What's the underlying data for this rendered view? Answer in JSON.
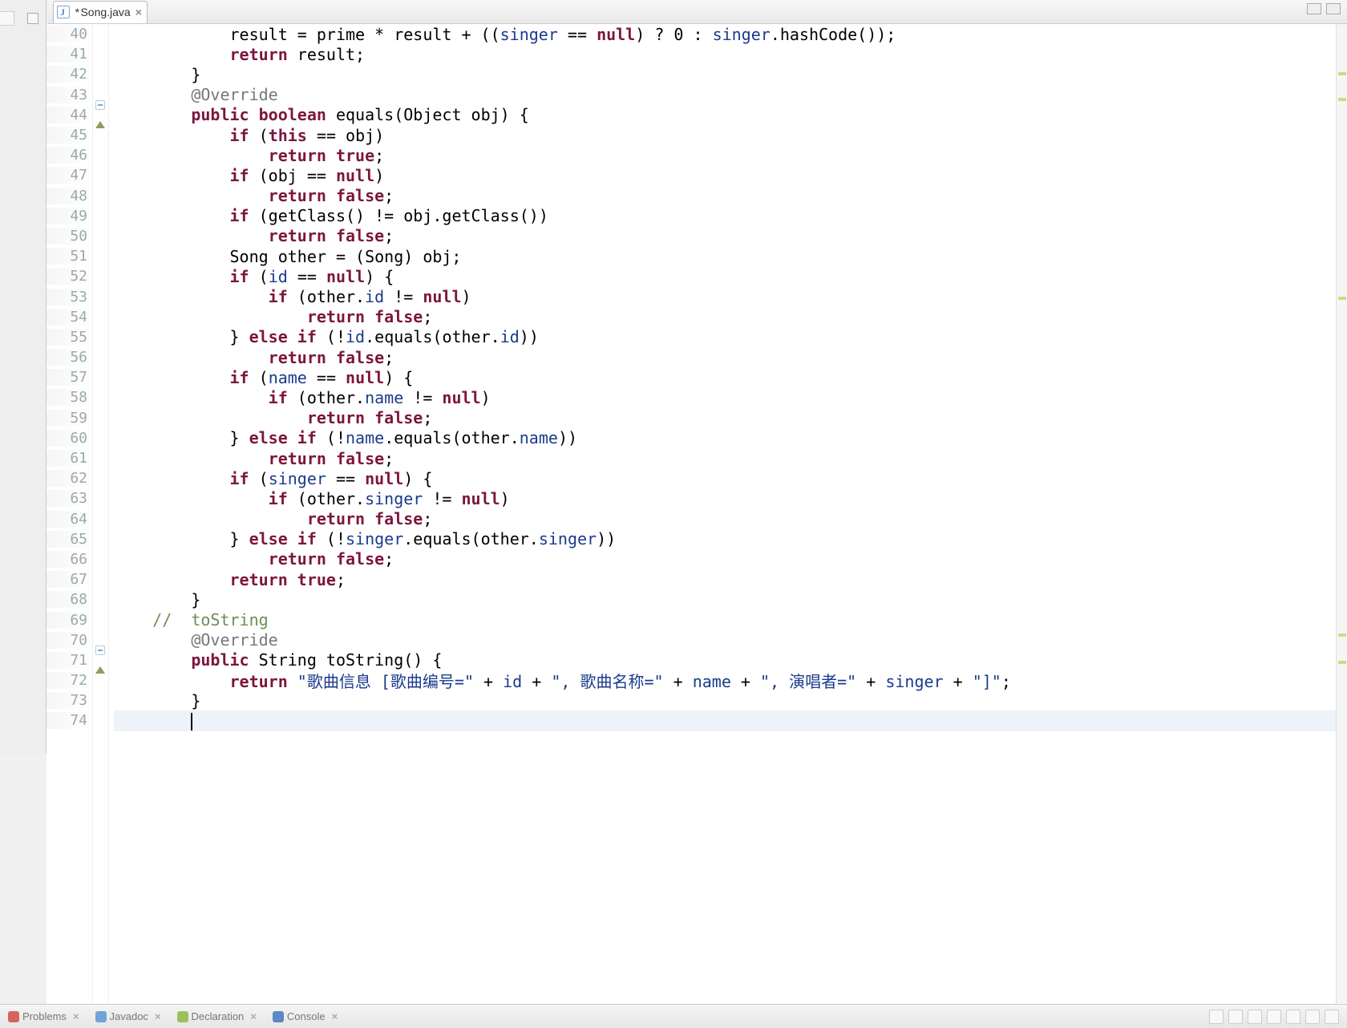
{
  "tab": {
    "filename": "Song.java",
    "dirty": true
  },
  "lines": [
    {
      "n": 40,
      "html": "            result = prime * result + ((<span class='fld'>singer</span> == <span class='kw'>null</span>) ? 0 : <span class='fld'>singer</span>.hashCode());"
    },
    {
      "n": 41,
      "html": "            <span class='kw'>return</span> result;"
    },
    {
      "n": 42,
      "html": "        }"
    },
    {
      "n": 43,
      "fold": true,
      "html": "        <span class='anno'>@Override</span>"
    },
    {
      "n": 44,
      "override": true,
      "html": "        <span class='kw'>public</span> <span class='kw'>boolean</span> equals(Object obj) {"
    },
    {
      "n": 45,
      "html": "            <span class='kw'>if</span> (<span class='kw'>this</span> == obj)"
    },
    {
      "n": 46,
      "html": "                <span class='kw'>return</span> <span class='kw'>true</span>;"
    },
    {
      "n": 47,
      "html": "            <span class='kw'>if</span> (obj == <span class='kw'>null</span>)"
    },
    {
      "n": 48,
      "html": "                <span class='kw'>return</span> <span class='kw'>false</span>;"
    },
    {
      "n": 49,
      "html": "            <span class='kw'>if</span> (getClass() != obj.getClass())"
    },
    {
      "n": 50,
      "html": "                <span class='kw'>return</span> <span class='kw'>false</span>;"
    },
    {
      "n": 51,
      "html": "            Song other = (Song) obj;"
    },
    {
      "n": 52,
      "html": "            <span class='kw'>if</span> (<span class='fld'>id</span> == <span class='kw'>null</span>) {"
    },
    {
      "n": 53,
      "html": "                <span class='kw'>if</span> (other.<span class='fld'>id</span> != <span class='kw'>null</span>)"
    },
    {
      "n": 54,
      "html": "                    <span class='kw'>return</span> <span class='kw'>false</span>;"
    },
    {
      "n": 55,
      "html": "            } <span class='kw'>else</span> <span class='kw'>if</span> (!<span class='fld'>id</span>.equals(other.<span class='fld'>id</span>))"
    },
    {
      "n": 56,
      "html": "                <span class='kw'>return</span> <span class='kw'>false</span>;"
    },
    {
      "n": 57,
      "html": "            <span class='kw'>if</span> (<span class='fld'>name</span> == <span class='kw'>null</span>) {"
    },
    {
      "n": 58,
      "html": "                <span class='kw'>if</span> (other.<span class='fld'>name</span> != <span class='kw'>null</span>)"
    },
    {
      "n": 59,
      "html": "                    <span class='kw'>return</span> <span class='kw'>false</span>;"
    },
    {
      "n": 60,
      "html": "            } <span class='kw'>else</span> <span class='kw'>if</span> (!<span class='fld'>name</span>.equals(other.<span class='fld'>name</span>))"
    },
    {
      "n": 61,
      "html": "                <span class='kw'>return</span> <span class='kw'>false</span>;"
    },
    {
      "n": 62,
      "html": "            <span class='kw'>if</span> (<span class='fld'>singer</span> == <span class='kw'>null</span>) {"
    },
    {
      "n": 63,
      "html": "                <span class='kw'>if</span> (other.<span class='fld'>singer</span> != <span class='kw'>null</span>)"
    },
    {
      "n": 64,
      "html": "                    <span class='kw'>return</span> <span class='kw'>false</span>;"
    },
    {
      "n": 65,
      "html": "            } <span class='kw'>else</span> <span class='kw'>if</span> (!<span class='fld'>singer</span>.equals(other.<span class='fld'>singer</span>))"
    },
    {
      "n": 66,
      "html": "                <span class='kw'>return</span> <span class='kw'>false</span>;"
    },
    {
      "n": 67,
      "html": "            <span class='kw'>return</span> <span class='kw'>true</span>;"
    },
    {
      "n": 68,
      "html": "        }"
    },
    {
      "n": 69,
      "html": "    <span class='cm'>//  toString</span>"
    },
    {
      "n": 70,
      "fold": true,
      "html": "        <span class='anno'>@Override</span>"
    },
    {
      "n": 71,
      "override": true,
      "html": "        <span class='kw'>public</span> String toString() {"
    },
    {
      "n": 72,
      "html": "            <span class='kw'>return</span> <span class='str'>\"歌曲信息 [歌曲编号=\"</span> + <span class='fld'>id</span> + <span class='str'>\", 歌曲名称=\"</span> + <span class='fld'>name</span> + <span class='str'>\", 演唱者=\"</span> + <span class='fld'>singer</span> + <span class='str'>\"]\"</span>;"
    },
    {
      "n": 73,
      "html": "        }"
    },
    {
      "n": 74,
      "cursor": true,
      "html": "        "
    }
  ],
  "bottomTabs": [
    {
      "name": "problems",
      "color": "#d9635d",
      "label": "Problems"
    },
    {
      "name": "javadoc",
      "color": "#6fa3d9",
      "label": "Javadoc"
    },
    {
      "name": "declaration",
      "color": "#9bc15f",
      "label": "Declaration"
    },
    {
      "name": "console",
      "color": "#5f86c6",
      "label": "Console"
    }
  ]
}
